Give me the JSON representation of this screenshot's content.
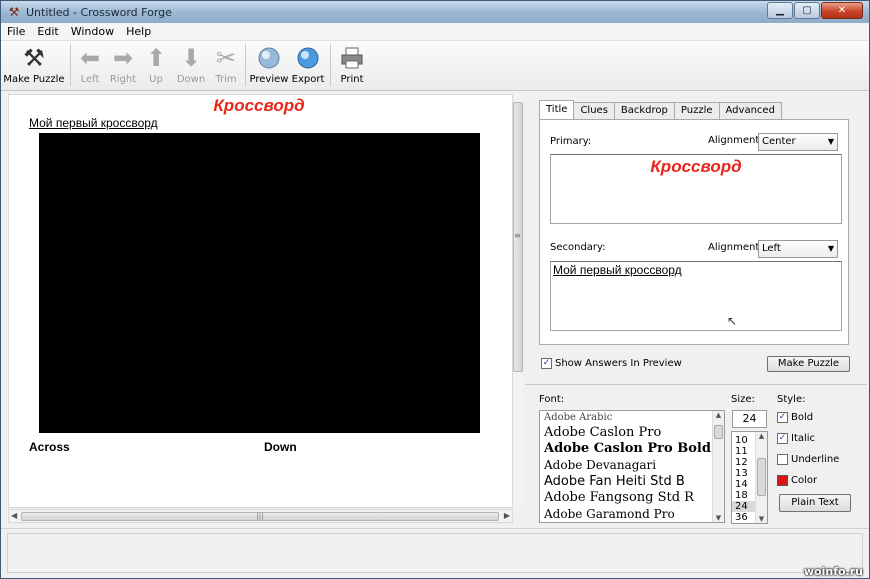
{
  "window": {
    "title": "Untitled - Crossword Forge"
  },
  "menu": [
    "File",
    "Edit",
    "Window",
    "Help"
  ],
  "toolbar": {
    "make_puzzle": "Make Puzzle",
    "left": "Left",
    "right": "Right",
    "up": "Up",
    "down": "Down",
    "trim": "Trim",
    "preview": "Preview",
    "export": "Export",
    "print": "Print"
  },
  "preview": {
    "title": "Кроссворд",
    "subtitle": "Мой первый кроссворд",
    "across": "Across",
    "down": "Down"
  },
  "tabs": [
    "Title",
    "Clues",
    "Backdrop",
    "Puzzle",
    "Advanced"
  ],
  "title_tab": {
    "primary_label": "Primary:",
    "primary_alignment_label": "Alignment:",
    "primary_alignment": "Center",
    "primary_text": "Кроссворд",
    "secondary_label": "Secondary:",
    "secondary_alignment_label": "Alignment:",
    "secondary_alignment": "Left",
    "secondary_text": "Мой первый кроссворд"
  },
  "show_answers": {
    "label": "Show Answers In Preview",
    "checked": true
  },
  "make_puzzle_button": "Make Puzzle",
  "font_panel": {
    "font_label": "Font:",
    "fonts": [
      "Adobe Arabic",
      "Adobe Caslon Pro",
      "Adobe Caslon Pro Bold",
      "Adobe Devanagari",
      "Adobe Fan Heiti Std B",
      "Adobe Fangsong Std R",
      "Adobe Garamond Pro"
    ],
    "size_label": "Size:",
    "size_value": "24",
    "sizes": [
      "10",
      "11",
      "12",
      "13",
      "14",
      "18",
      "24",
      "36"
    ],
    "style_label": "Style:",
    "bold": "Bold",
    "italic": "Italic",
    "underline": "Underline",
    "color": "Color",
    "plain_text": "Plain Text",
    "colors": {
      "text_color": "#d91515"
    }
  },
  "watermark": "woinfo.ru"
}
